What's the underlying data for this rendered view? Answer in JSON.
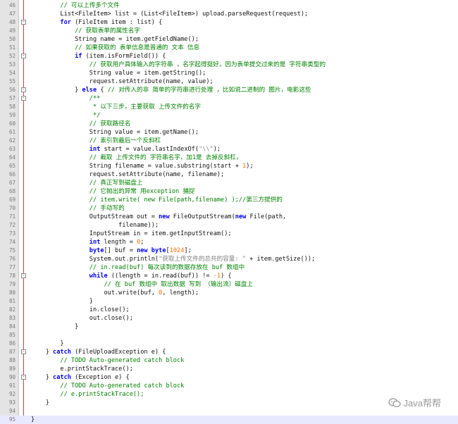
{
  "editor": {
    "lines": [
      {
        "n": "46",
        "mk": "",
        "seg": [
          [
            "        ",
            ""
          ],
          [
            "// 可以上传多个文件",
            "c"
          ]
        ]
      },
      {
        "n": "47",
        "mk": "",
        "seg": [
          [
            "        List<FileItem> list = (List<FileItem>) upload.parseRequest(request);",
            ""
          ]
        ]
      },
      {
        "n": "48",
        "mk": "-",
        "seg": [
          [
            "        ",
            ""
          ],
          [
            "for",
            "k"
          ],
          [
            " (FileItem item : list) {",
            ""
          ]
        ]
      },
      {
        "n": "49",
        "mk": "",
        "seg": [
          [
            "            ",
            ""
          ],
          [
            "// 获取表单的属性名字",
            "c"
          ]
        ]
      },
      {
        "n": "50",
        "mk": "",
        "seg": [
          [
            "            String name = item.getFieldName();",
            ""
          ]
        ]
      },
      {
        "n": "51",
        "mk": "",
        "seg": [
          [
            "            ",
            ""
          ],
          [
            "// 如果获取的 表单信息是普通的 文本 信息",
            "c"
          ]
        ]
      },
      {
        "n": "52",
        "mk": "-",
        "seg": [
          [
            "            ",
            ""
          ],
          [
            "if",
            "k"
          ],
          [
            " (item.isFormField()) {",
            ""
          ]
        ]
      },
      {
        "n": "53",
        "mk": "",
        "seg": [
          [
            "                ",
            ""
          ],
          [
            "// 获取用户具体输入的字符串 ，名字起得挺好，因为表单提交过来的是 字符串类型的",
            "c"
          ]
        ]
      },
      {
        "n": "54",
        "mk": "",
        "seg": [
          [
            "                String value = item.getString();",
            ""
          ]
        ]
      },
      {
        "n": "55",
        "mk": "",
        "seg": [
          [
            "                request.setAttribute(name, value);",
            ""
          ]
        ]
      },
      {
        "n": "56",
        "mk": "-",
        "seg": [
          [
            "            } ",
            ""
          ],
          [
            "else",
            "k"
          ],
          [
            " { ",
            ""
          ],
          [
            "// 对传入的非 简单的字符串进行处理 ，比如说二进制的 图片，电影这些",
            "c"
          ]
        ]
      },
      {
        "n": "57",
        "mk": "-",
        "seg": [
          [
            "                ",
            ""
          ],
          [
            "/**",
            "c"
          ]
        ]
      },
      {
        "n": "58",
        "mk": "",
        "seg": [
          [
            "                 ",
            ""
          ],
          [
            "* 以下三步，主要获取 上传文件的名字",
            "c"
          ]
        ]
      },
      {
        "n": "59",
        "mk": "",
        "seg": [
          [
            "                 ",
            ""
          ],
          [
            "*/",
            "c"
          ]
        ]
      },
      {
        "n": "60",
        "mk": "",
        "seg": [
          [
            "                ",
            ""
          ],
          [
            "// 获取路径名",
            "c"
          ]
        ]
      },
      {
        "n": "61",
        "mk": "",
        "seg": [
          [
            "                String value = item.getName();",
            ""
          ]
        ]
      },
      {
        "n": "62",
        "mk": "",
        "seg": [
          [
            "                ",
            ""
          ],
          [
            "// 索引到最后一个反斜杠",
            "c"
          ]
        ]
      },
      {
        "n": "63",
        "mk": "",
        "seg": [
          [
            "                ",
            ""
          ],
          [
            "int",
            "k"
          ],
          [
            " start = value.lastIndexOf(",
            ""
          ],
          [
            "\"\\\\\"",
            "s"
          ],
          [
            ");",
            ""
          ]
        ]
      },
      {
        "n": "64",
        "mk": "",
        "seg": [
          [
            "                ",
            ""
          ],
          [
            "// 截取 上传文件的 字符串名字，加1是 去掉反斜杠，",
            "c"
          ]
        ]
      },
      {
        "n": "65",
        "mk": "",
        "seg": [
          [
            "                String filename = value.substring(start + ",
            ""
          ],
          [
            "1",
            "n"
          ],
          [
            ");",
            ""
          ]
        ]
      },
      {
        "n": "66",
        "mk": "",
        "seg": [
          [
            "                request.setAttribute(name, filename);",
            ""
          ]
        ]
      },
      {
        "n": "67",
        "mk": "",
        "seg": [
          [
            "                ",
            ""
          ],
          [
            "// 真正写到磁盘上",
            "c"
          ]
        ]
      },
      {
        "n": "68",
        "mk": "",
        "seg": [
          [
            "                ",
            ""
          ],
          [
            "// 它抛出的异常 用exception 捕捉",
            "c"
          ]
        ]
      },
      {
        "n": "69",
        "mk": "",
        "seg": [
          [
            "                ",
            ""
          ],
          [
            "// item.write( new File(path,filename) );//第三方提供的",
            "c"
          ]
        ]
      },
      {
        "n": "70",
        "mk": "",
        "seg": [
          [
            "                ",
            ""
          ],
          [
            "// 手动写的",
            "c"
          ]
        ]
      },
      {
        "n": "71",
        "mk": "",
        "seg": [
          [
            "                OutputStream out = ",
            ""
          ],
          [
            "new",
            "k"
          ],
          [
            " FileOutputStream(",
            ""
          ],
          [
            "new",
            "k"
          ],
          [
            " File(path,",
            ""
          ]
        ]
      },
      {
        "n": "72",
        "mk": "",
        "seg": [
          [
            "                        filename));",
            ""
          ]
        ]
      },
      {
        "n": "73",
        "mk": "",
        "seg": [
          [
            "                InputStream in = item.getInputStream();",
            ""
          ]
        ]
      },
      {
        "n": "74",
        "mk": "",
        "seg": [
          [
            "                ",
            ""
          ],
          [
            "int",
            "k"
          ],
          [
            " length = ",
            ""
          ],
          [
            "0",
            "n"
          ],
          [
            ";",
            ""
          ]
        ]
      },
      {
        "n": "75",
        "mk": "",
        "seg": [
          [
            "                ",
            ""
          ],
          [
            "byte",
            "k"
          ],
          [
            "[] buf = ",
            ""
          ],
          [
            "new",
            "k"
          ],
          [
            " ",
            ""
          ],
          [
            "byte",
            "k"
          ],
          [
            "[",
            ""
          ],
          [
            "1024",
            "n"
          ],
          [
            "];",
            ""
          ]
        ]
      },
      {
        "n": "76",
        "mk": "",
        "seg": [
          [
            "                System.out.println(",
            ""
          ],
          [
            "\"获取上传文件的总共的容量: \"",
            "s"
          ],
          [
            " + item.getSize());",
            ""
          ]
        ]
      },
      {
        "n": "77",
        "mk": "",
        "seg": [
          [
            "                ",
            ""
          ],
          [
            "// in.read(buf) 每次读到的数据存放在 buf 数组中",
            "c"
          ]
        ]
      },
      {
        "n": "78",
        "mk": "-",
        "seg": [
          [
            "                ",
            ""
          ],
          [
            "while",
            "k"
          ],
          [
            " ((length = in.read(buf)) != ",
            ""
          ],
          [
            "-1",
            "n"
          ],
          [
            ") {",
            ""
          ]
        ]
      },
      {
        "n": "79",
        "mk": "",
        "seg": [
          [
            "                    ",
            ""
          ],
          [
            "// 在 buf 数组中 取出数据 写到 （输出流）磁盘上",
            "c"
          ]
        ]
      },
      {
        "n": "80",
        "mk": "",
        "seg": [
          [
            "                    out.write(buf, ",
            ""
          ],
          [
            "0",
            "n"
          ],
          [
            ", length);",
            ""
          ]
        ]
      },
      {
        "n": "81",
        "mk": "",
        "seg": [
          [
            "                }",
            ""
          ]
        ]
      },
      {
        "n": "82",
        "mk": "",
        "seg": [
          [
            "                in.close();",
            ""
          ]
        ]
      },
      {
        "n": "83",
        "mk": "",
        "seg": [
          [
            "                out.close();",
            ""
          ]
        ]
      },
      {
        "n": "84",
        "mk": "",
        "seg": [
          [
            "            }",
            ""
          ]
        ]
      },
      {
        "n": "85",
        "mk": "",
        "seg": [
          [
            "",
            ""
          ]
        ]
      },
      {
        "n": "86",
        "mk": "",
        "seg": [
          [
            "        }",
            ""
          ]
        ]
      },
      {
        "n": "87",
        "mk": "-",
        "seg": [
          [
            "    } ",
            ""
          ],
          [
            "catch",
            "k"
          ],
          [
            " (FileUploadException e) {",
            ""
          ]
        ]
      },
      {
        "n": "88",
        "mk": "",
        "seg": [
          [
            "        ",
            ""
          ],
          [
            "// TODO Auto-generated catch block",
            "c"
          ]
        ]
      },
      {
        "n": "89",
        "mk": "",
        "seg": [
          [
            "        e.printStackTrace();",
            ""
          ]
        ]
      },
      {
        "n": "90",
        "mk": "-",
        "seg": [
          [
            "    } ",
            ""
          ],
          [
            "catch",
            "k"
          ],
          [
            " (Exception e) {",
            ""
          ]
        ]
      },
      {
        "n": "91",
        "mk": "",
        "seg": [
          [
            "        ",
            ""
          ],
          [
            "// TODO Auto-generated catch block",
            "c"
          ]
        ]
      },
      {
        "n": "92",
        "mk": "",
        "seg": [
          [
            "        ",
            ""
          ],
          [
            "// e.printStackTrace();",
            "c"
          ]
        ]
      },
      {
        "n": "93",
        "mk": "",
        "seg": [
          [
            "    }",
            ""
          ]
        ]
      },
      {
        "n": "94",
        "mk": "",
        "seg": [
          [
            "",
            ""
          ]
        ]
      },
      {
        "n": "95",
        "mk": "",
        "seg": [
          [
            "}",
            ""
          ]
        ]
      }
    ]
  },
  "watermark": {
    "text": "Java帮帮",
    "icon": "wechat-icon",
    "color": "#9a9a9a"
  }
}
